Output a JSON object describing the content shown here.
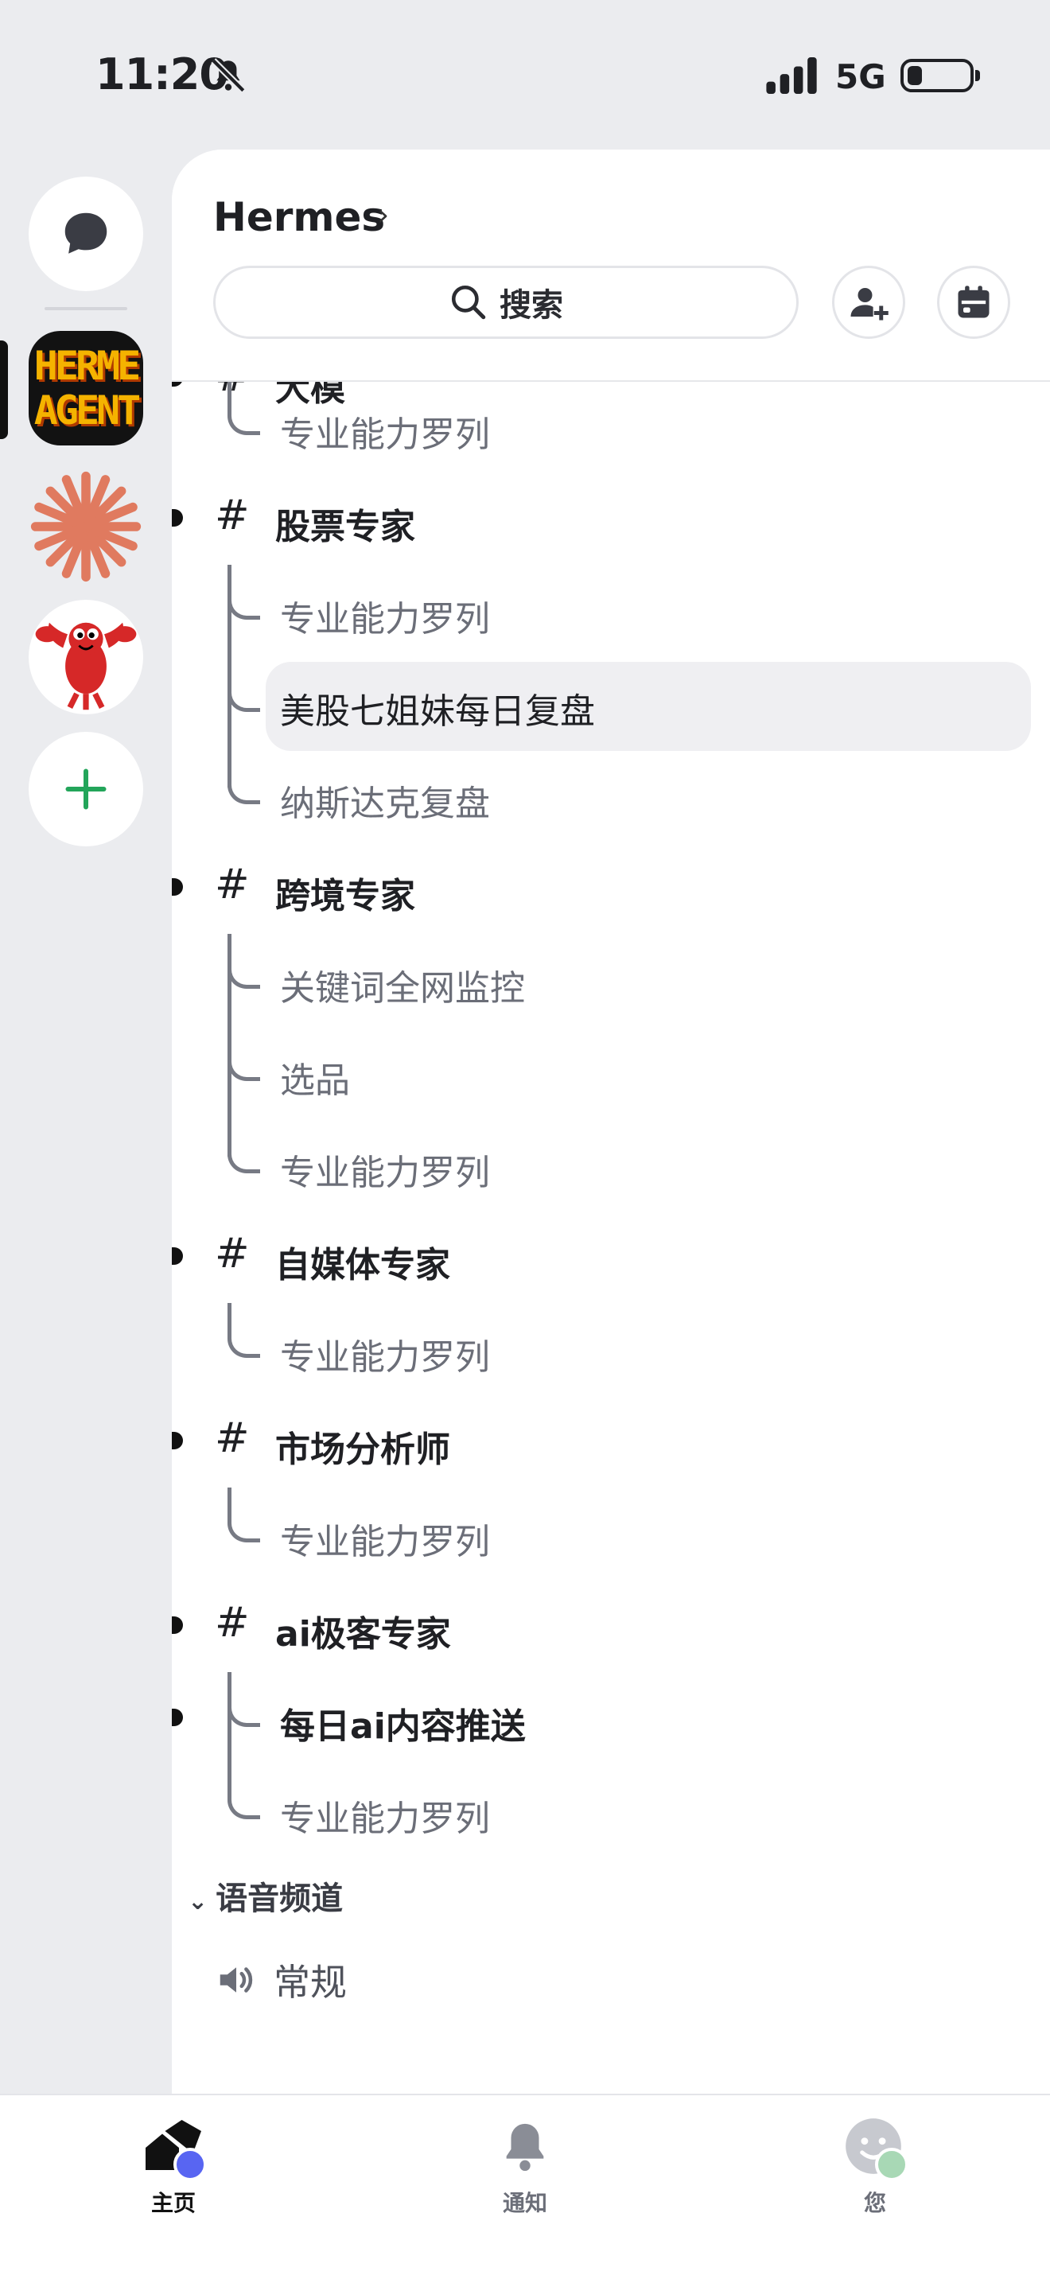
{
  "status_bar": {
    "time": "11:20",
    "network": "5G"
  },
  "header": {
    "server_name": "Hermes",
    "chevron": "›",
    "search_label": "搜索"
  },
  "partial_category": "大模",
  "channels": [
    {
      "type": "thread",
      "label": "专业能力罗列"
    },
    {
      "type": "category",
      "label": "股票专家"
    },
    {
      "type": "thread",
      "label": "专业能力罗列"
    },
    {
      "type": "thread",
      "label": "美股七姐妹每日复盘",
      "selected": true
    },
    {
      "type": "thread",
      "label": "纳斯达克复盘"
    },
    {
      "type": "category",
      "label": "跨境专家"
    },
    {
      "type": "thread",
      "label": "关键词全网监控"
    },
    {
      "type": "thread",
      "label": "选品"
    },
    {
      "type": "thread",
      "label": "专业能力罗列"
    },
    {
      "type": "category",
      "label": "自媒体专家"
    },
    {
      "type": "thread",
      "label": "专业能力罗列"
    },
    {
      "type": "category",
      "label": "市场分析师"
    },
    {
      "type": "thread",
      "label": "专业能力罗列"
    },
    {
      "type": "category",
      "label": "ai极客专家"
    },
    {
      "type": "thread",
      "label": "每日ai内容推送",
      "unread": true
    },
    {
      "type": "thread",
      "label": "专业能力罗列"
    }
  ],
  "hash_symbol": "#",
  "voice_section": {
    "title": "语音频道",
    "channel": "常规"
  },
  "servers": [
    "direct-messages",
    "hermes-agent",
    "claude-burst",
    "lobster",
    "add-server"
  ],
  "hermes_logo_text": [
    "HERME",
    "AGENT"
  ],
  "tabbar": {
    "home": "主页",
    "notifications": "通知",
    "you": "您"
  },
  "colors": {
    "accent_blue": "#5865f2",
    "add_green": "#23a55a",
    "claude_orange": "#e07a5f",
    "lobster_red": "#d62828"
  }
}
